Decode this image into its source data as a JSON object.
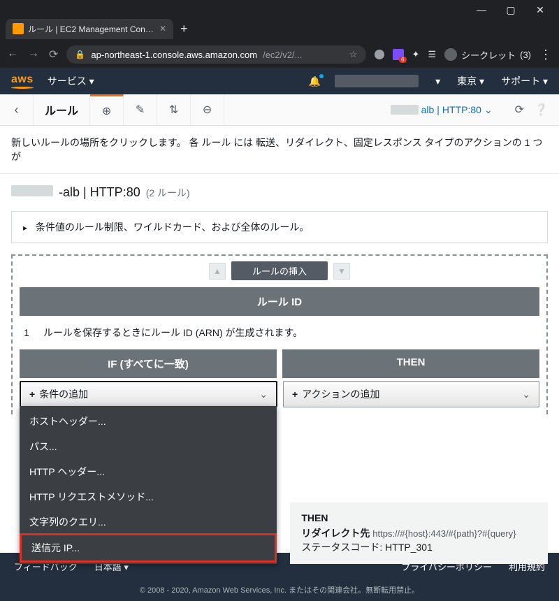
{
  "chrome": {
    "tab_title": "ルール | EC2 Management Console",
    "url_host": "ap-northeast-1.console.aws.amazon.com",
    "url_path": "/ec2/v2/...",
    "incognito_label": "シークレット",
    "incognito_count": "(3)"
  },
  "aws": {
    "logo": "aws",
    "services": "サービス ▾",
    "region": "東京 ▾",
    "support": "サポート ▾"
  },
  "toolbar": {
    "rules_label": "ルール",
    "listener_suffix": "alb",
    "listener_proto": "HTTP:80"
  },
  "hint": "新しいルールの場所をクリックします。 各 ルール には 転送、リダイレクト、固定レスポンス タイプのアクションの 1 つが",
  "listener": {
    "suffix": "-alb | HTTP:80",
    "count": "(2 ルール)"
  },
  "accordion": "条件値のルール制限、ワイルドカード、および全体のルール。",
  "insert": {
    "label": "ルールの挿入",
    "rule_id": "ルール ID",
    "rule_num": "1",
    "rule_desc": "ルールを保存するときにルール ID (ARN) が生成されます。",
    "if_label": "IF (すべてに一致)",
    "then_label": "THEN",
    "add_condition": "条件の追加",
    "add_action": "アクションの追加"
  },
  "menu": {
    "host_header": "ホストヘッダー...",
    "path": "パス...",
    "http_header": "HTTP ヘッダー...",
    "http_method": "HTTP リクエストメソッド...",
    "query_string": "文字列のクエリ...",
    "source_ip": "送信元 IP..."
  },
  "then_rule": {
    "then": "THEN",
    "redirect_label": "リダイレクト先",
    "redirect_value": "https://#{host}:443/#{path}?#{query}",
    "status_label": "ステータスコード:",
    "status_value": "HTTP_301"
  },
  "footer": {
    "feedback": "フィードバック",
    "lang": "日本語 ▾",
    "privacy": "プライバシーポリシー",
    "terms": "利用規約",
    "copyright": "© 2008 - 2020, Amazon Web Services, Inc. またはその関連会社。無断転用禁止。"
  }
}
